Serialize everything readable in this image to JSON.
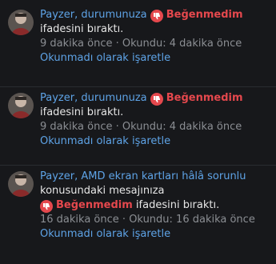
{
  "notifications": [
    {
      "user": "Payzer",
      "separator": ",",
      "target": "durumunuza",
      "reaction": "Beğenmedim",
      "rest": "ifadesini bıraktı.",
      "time": "9 dakika önce",
      "dot": "·",
      "read_time": "Okundu: 4 dakika önce",
      "mark_unread": "Okunmadı olarak işaretle"
    },
    {
      "user": "Payzer",
      "separator": ",",
      "target": "durumunuza",
      "reaction": "Beğenmedim",
      "rest": "ifadesini bıraktı.",
      "time": "9 dakika önce",
      "dot": "·",
      "read_time": "Okundu: 4 dakika önce",
      "mark_unread": "Okunmadı olarak işaretle"
    },
    {
      "user": "Payzer",
      "separator": ",",
      "target": "AMD ekran kartları hâlâ sorunlu",
      "pre_reaction": "konusundaki mesajınıza",
      "reaction": "Beğenmedim",
      "rest": "ifadesini bıraktı.",
      "time": "16 dakika önce",
      "dot": "·",
      "read_time": "Okundu: 16 dakika önce",
      "mark_unread": "Okunmadı olarak işaretle"
    }
  ],
  "icons": {
    "reaction": "thumbs-down-icon",
    "avatar": "avatar"
  },
  "colors": {
    "background": "#17181b",
    "link": "#5ea3e6",
    "reaction": "#e5484d",
    "meta": "#8b8e93",
    "text": "#e6e6e6"
  }
}
